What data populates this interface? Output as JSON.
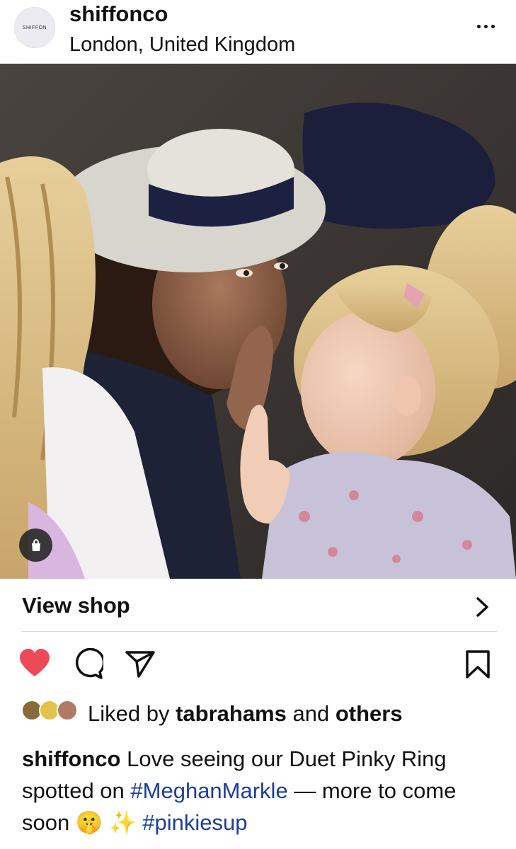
{
  "post": {
    "username": "shiffonco",
    "location": "London, United Kingdom",
    "avatar_text": "SHIFFON",
    "more_icon": "more-horizontal-icon"
  },
  "shop": {
    "label": "View shop"
  },
  "actions": {
    "liked": true,
    "like_color": "#ed4956",
    "icons": [
      "heart-icon",
      "comment-icon",
      "share-icon",
      "bookmark-icon"
    ]
  },
  "likes": {
    "prefix": "Liked by ",
    "user": "tabrahams",
    "middle": " and ",
    "others": "others"
  },
  "caption": {
    "username": "shiffonco",
    "text_1": " Love seeing our Duet Pinky Ring spotted on ",
    "hashtag_1": "#MeghanMarkle",
    "text_2": " — more to come soon 🤫 ✨ ",
    "hashtag_2": "#pinkiesup",
    "hashtag_color": "#1b3e9c"
  }
}
